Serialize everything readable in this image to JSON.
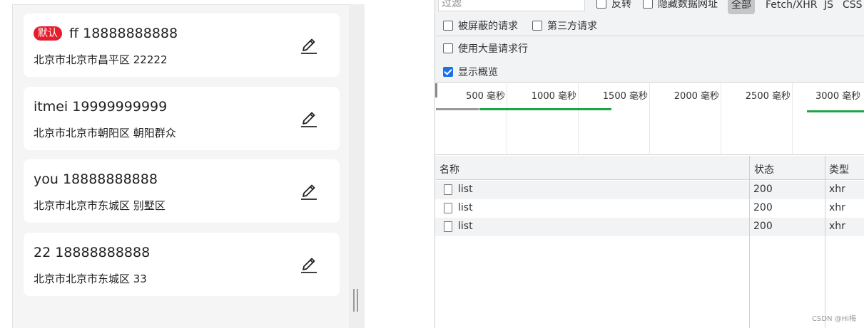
{
  "addresses": [
    {
      "is_default": true,
      "default_label": "默认",
      "line1": "ff 18888888888",
      "line2": "北京市北京市昌平区 22222"
    },
    {
      "is_default": false,
      "line1": "itmei 19999999999",
      "line2": "北京市北京市朝阳区 朝阳群众"
    },
    {
      "is_default": false,
      "line1": "you 18888888888",
      "line2": "北京市北京市东城区 别墅区"
    },
    {
      "is_default": false,
      "line1": "22 18888888888",
      "line2": "北京市北京市东城区 33"
    }
  ],
  "toolbar": {
    "filter_placeholder": "过滤",
    "invert_label": "反转",
    "hide_data_urls_label": "隐藏数据网址",
    "type_all": "全部",
    "type_fetch": "Fetch/XHR",
    "type_js": "JS",
    "type_css": "CSS",
    "blocked_requests_label": "被屏蔽的请求",
    "third_party_label": "第三方请求",
    "large_rows_label": "使用大量请求行",
    "show_overview_label": "显示概览",
    "show_overview_checked": true
  },
  "overview": {
    "ticks": [
      "500 毫秒",
      "1000 毫秒",
      "1500 毫秒",
      "2000 毫秒",
      "2500 毫秒",
      "3000 毫秒"
    ]
  },
  "table": {
    "headers": {
      "name": "名称",
      "status": "状态",
      "type": "类型"
    },
    "rows": [
      {
        "name": "list",
        "status": "200",
        "type": "xhr"
      },
      {
        "name": "list",
        "status": "200",
        "type": "xhr"
      },
      {
        "name": "list",
        "status": "200",
        "type": "xhr"
      }
    ]
  },
  "watermark": "CSDN @Hi梅",
  "colors": {
    "default_badge": "#e41e2d",
    "checkbox_checked": "#1a73e8",
    "waterfall_green": "#1ea446",
    "waterfall_gray": "#9a9a9a"
  }
}
